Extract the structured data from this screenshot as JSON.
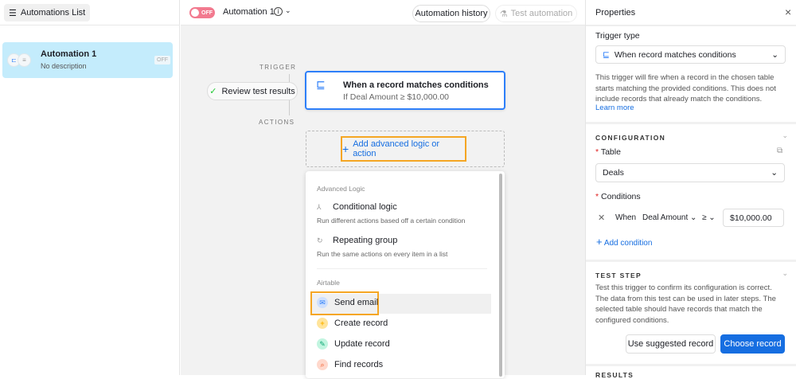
{
  "sidebar": {
    "list_button": "Automations List",
    "automation": {
      "name": "Automation 1",
      "description": "No description",
      "status": "OFF"
    }
  },
  "topbar": {
    "toggle": "OFF",
    "title": "Automation 1",
    "history_button": "Automation history",
    "test_button": "Test automation"
  },
  "canvas": {
    "trigger_label": "TRIGGER",
    "actions_label": "ACTIONS",
    "review_button": "Review test results",
    "trigger_card": {
      "title": "When a record matches conditions",
      "subtitle": "If Deal Amount ≥ $10,000.00"
    },
    "add_button": "Add advanced logic or action",
    "menu": {
      "advanced_header": "Advanced Logic",
      "conditional": {
        "label": "Conditional logic",
        "desc": "Run different actions based off a certain condition"
      },
      "repeating": {
        "label": "Repeating group",
        "desc": "Run the same actions on every item in a list"
      },
      "airtable_header": "Airtable",
      "items": [
        {
          "label": "Send email",
          "color": "#2d7ff9"
        },
        {
          "label": "Create record",
          "color": "#fcb400"
        },
        {
          "label": "Update record",
          "color": "#20c933"
        },
        {
          "label": "Find records",
          "color": "#f82b60"
        }
      ]
    }
  },
  "panel": {
    "title": "Properties",
    "trigger_type_label": "Trigger type",
    "trigger_type_value": "When record matches conditions",
    "trigger_desc": "This trigger will fire when a record in the chosen table starts matching the provided conditions. This does not include records that already match the conditions.",
    "learn_more": "Learn more",
    "configuration": "CONFIGURATION",
    "table_label": "Table",
    "table_value": "Deals",
    "conditions_label": "Conditions",
    "condition": {
      "when": "When",
      "field": "Deal Amount",
      "operator": "≥",
      "value": "$10,000.00"
    },
    "add_condition": "Add condition",
    "test_step": "TEST STEP",
    "test_desc": "Test this trigger to confirm its configuration is correct. The data from this test can be used in later steps. The selected table should have records that match the configured conditions.",
    "use_suggested": "Use suggested record",
    "choose_record": "Choose record",
    "results": "RESULTS"
  }
}
